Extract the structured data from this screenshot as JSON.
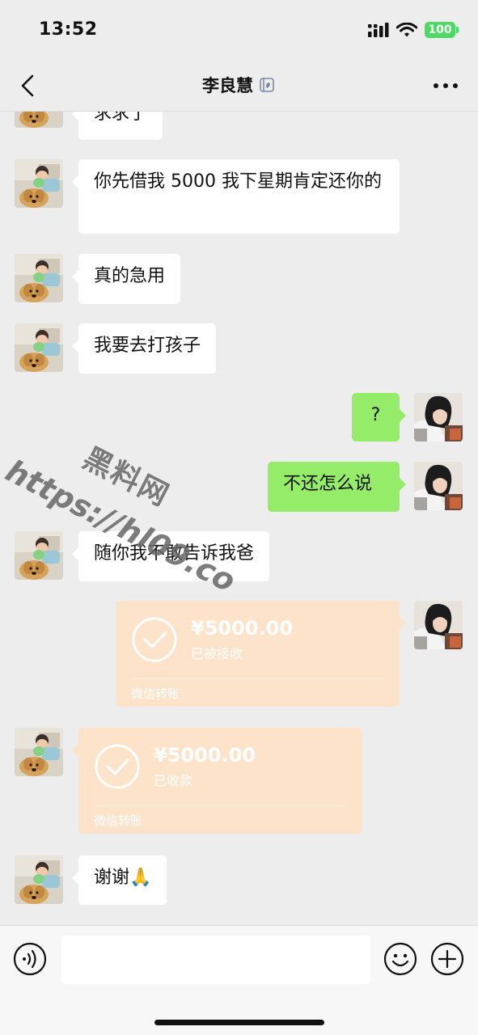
{
  "status_bar": {
    "time": "13:52",
    "battery": "100",
    "icons": [
      "signal-icon",
      "wifi-icon",
      "battery-icon"
    ]
  },
  "header": {
    "title": "李良慧",
    "title_icon": "wechat-work-icon",
    "back_icon": "back-chevron-icon",
    "more_icon": "more-dots-icon"
  },
  "messages": [
    {
      "side": "left",
      "type": "text",
      "text": "求求了"
    },
    {
      "side": "left",
      "type": "text",
      "text": "你先借我 5000 我下星期肯定还你的"
    },
    {
      "side": "left",
      "type": "text",
      "text": "真的急用"
    },
    {
      "side": "left",
      "type": "text",
      "text": "我要去打孩子"
    },
    {
      "side": "right",
      "type": "text",
      "text": "?"
    },
    {
      "side": "right",
      "type": "text",
      "text": "不还怎么说"
    },
    {
      "side": "left",
      "type": "text",
      "text": "随你我不敢告诉我爸"
    },
    {
      "side": "right",
      "type": "transfer",
      "amount": "¥5000.00",
      "status": "已被接收",
      "label": "微信转账"
    },
    {
      "side": "left",
      "type": "transfer",
      "amount": "¥5000.00",
      "status": "已收款",
      "label": "微信转账"
    },
    {
      "side": "left",
      "type": "text",
      "text": "谢谢🙏"
    }
  ],
  "watermark": {
    "chinese": "黑料网",
    "url": "https://hl09.co"
  },
  "input_bar": {
    "voice_icon": "voice-icon",
    "input_value": "",
    "emoji_icon": "emoji-icon",
    "plus_icon": "plus-icon"
  },
  "colors": {
    "background": "#ededed",
    "sent_bubble": "#95ec69",
    "received_bubble": "#ffffff",
    "transfer_card": "#fde3c9",
    "battery": "#4cd964"
  }
}
